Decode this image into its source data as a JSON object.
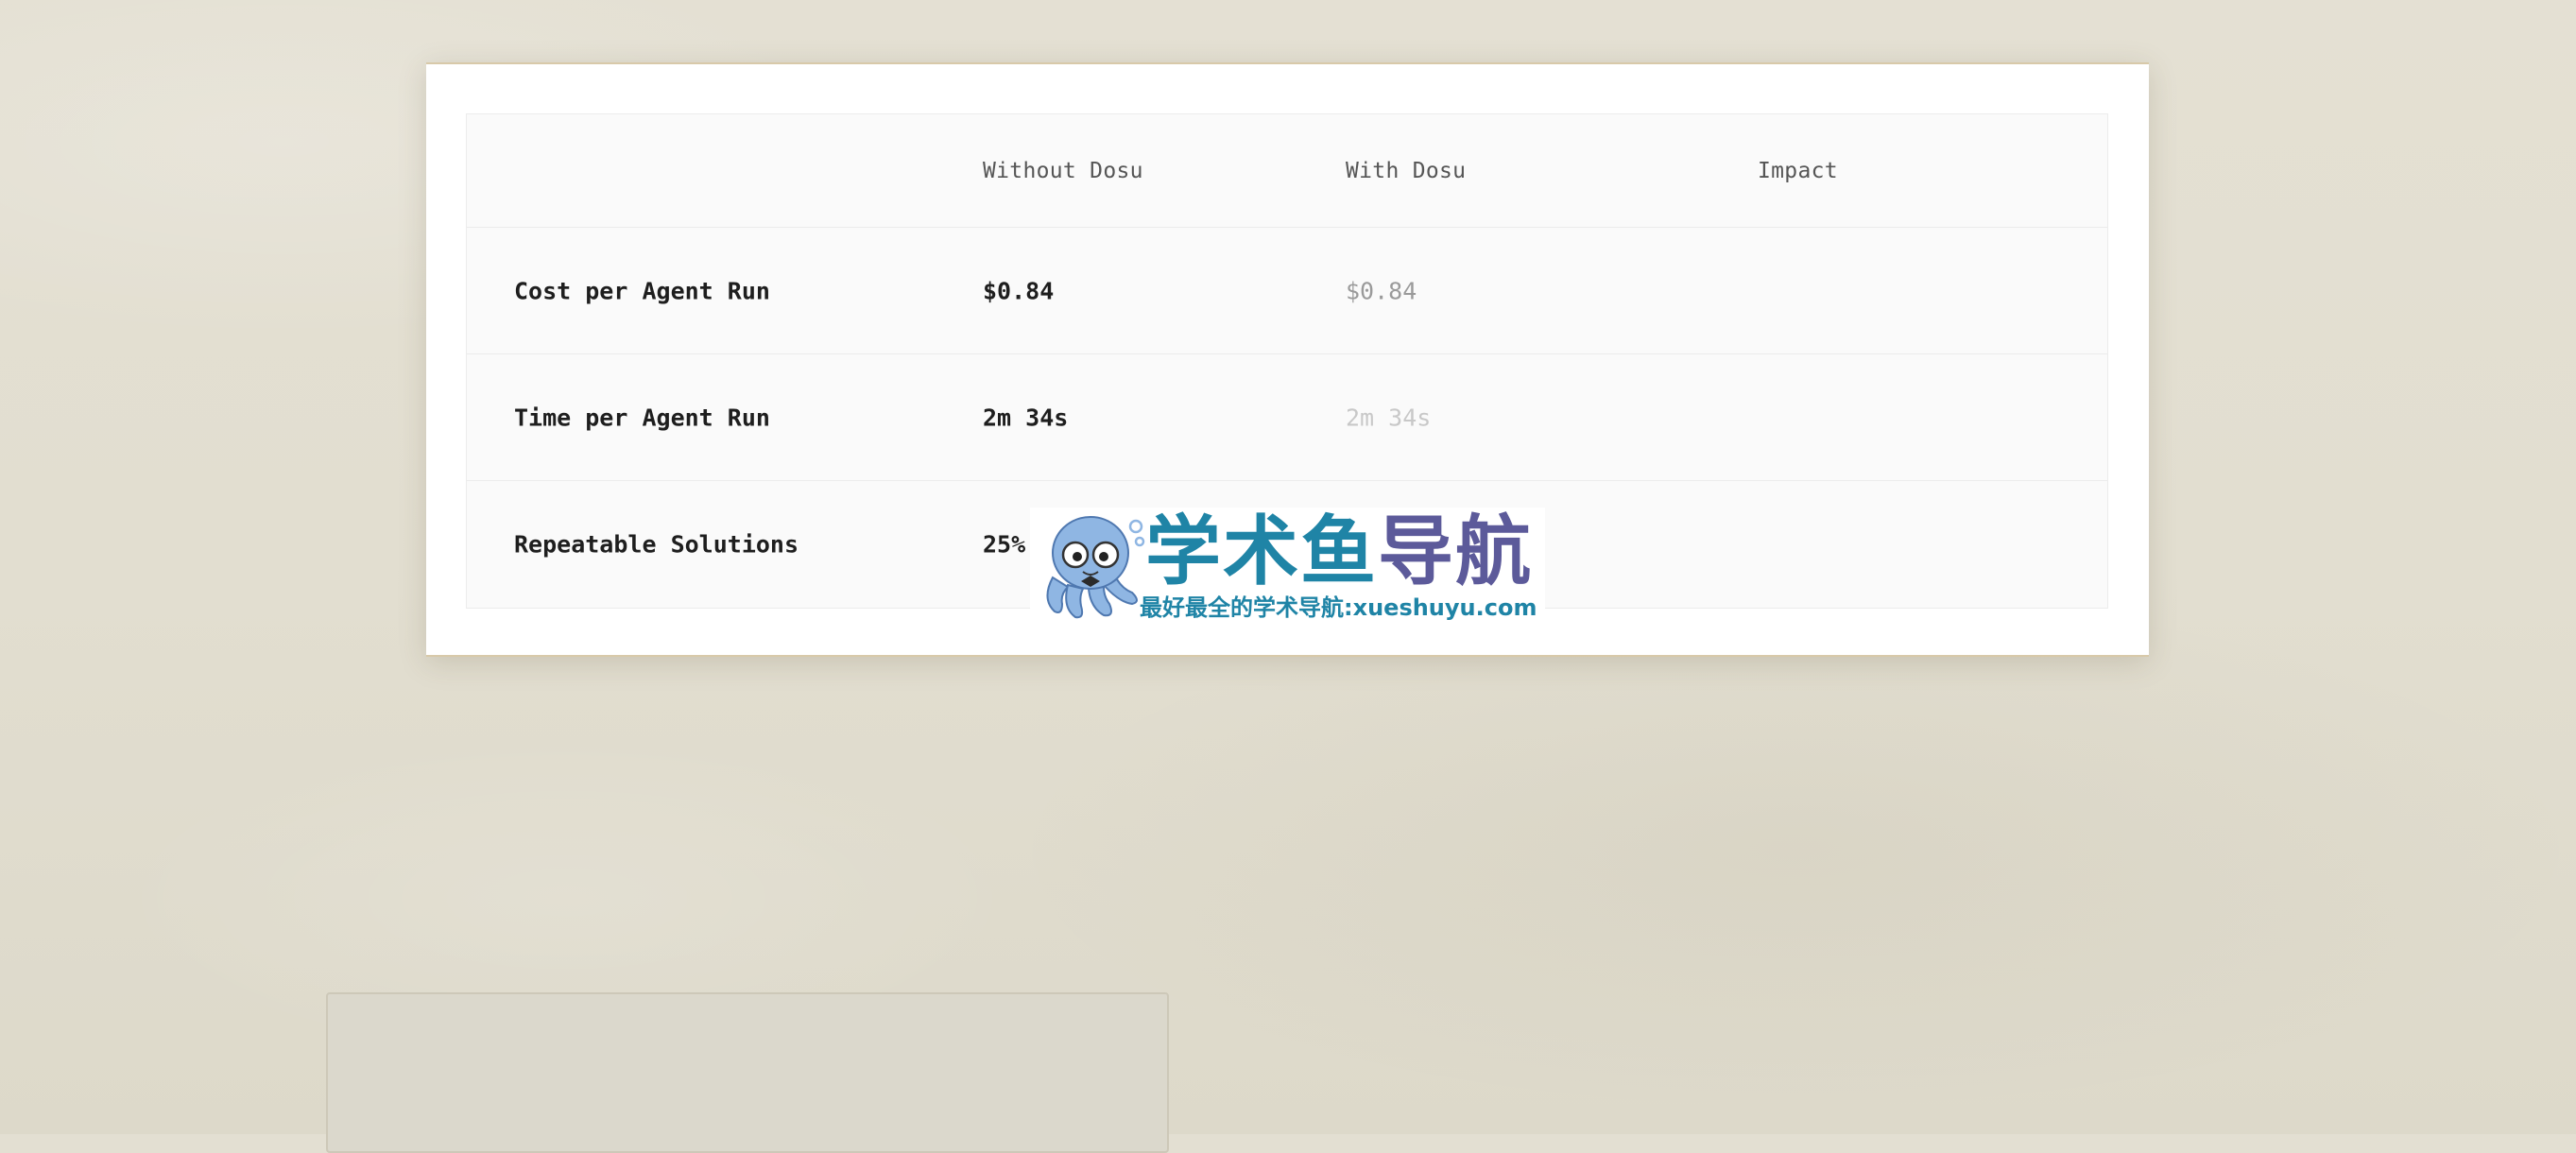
{
  "comparison_table": {
    "headers": [
      "",
      "Without Dosu",
      "With Dosu",
      "Impact"
    ],
    "rows": [
      {
        "label": "Cost per Agent Run",
        "without": "$0.84",
        "with": "$0.84",
        "impact": ""
      },
      {
        "label": "Time per Agent Run",
        "without": "2m 34s",
        "with": "2m 34s",
        "impact": ""
      },
      {
        "label": "Repeatable Solutions",
        "without": "25%",
        "with": "",
        "impact": ""
      }
    ]
  },
  "watermark": {
    "title_part1": "学术鱼",
    "title_part2": "导航",
    "subtitle": "最好最全的学术导航:xueshuyu.com"
  },
  "colors": {
    "page_background": "#e3dfd2",
    "card_background": "#ffffff",
    "card_border_accent": "#d8c9a9",
    "watermark_teal": "#1f84a6",
    "watermark_purple": "#5c5a9a"
  }
}
